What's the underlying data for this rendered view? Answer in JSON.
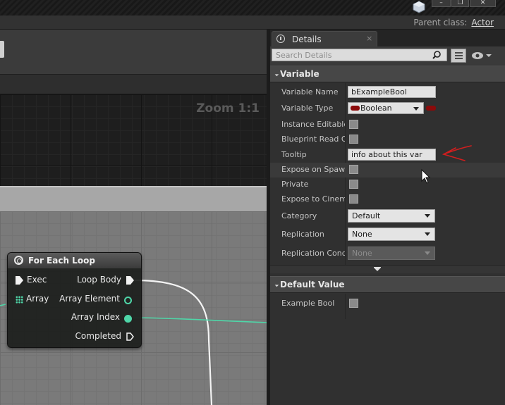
{
  "window": {
    "minimize_glyph": "–",
    "maximize_glyph": "❐",
    "close_glyph": "✕",
    "logo_icon": "unreal-engine-icon"
  },
  "toolbar": {
    "parent_class_label": "Parent class:",
    "parent_class_value": "Actor"
  },
  "graph": {
    "zoom_label": "Zoom 1:1",
    "node": {
      "title": "For Each Loop",
      "icon": "loop-icon",
      "inputs": [
        {
          "label": "Exec",
          "pin": "exec"
        },
        {
          "label": "Array",
          "pin": "array"
        }
      ],
      "outputs": [
        {
          "label": "Loop Body",
          "pin": "exec"
        },
        {
          "label": "Array Element",
          "pin": "data-hollow"
        },
        {
          "label": "Array Index",
          "pin": "data-filled"
        },
        {
          "label": "Completed",
          "pin": "exec-hollow"
        }
      ]
    },
    "colors": {
      "wire_exec": "#ffffff",
      "wire_int": "#4fd6a8"
    }
  },
  "details": {
    "tab_label": "Details",
    "tab_close": "×",
    "search_placeholder": "Search Details",
    "sections": {
      "variable": "Variable",
      "default_value": "Default Value"
    },
    "properties": {
      "variable_name": {
        "label": "Variable Name",
        "value": "bExampleBool"
      },
      "variable_type": {
        "label": "Variable Type",
        "value": "Boolean"
      },
      "instance_editable": {
        "label": "Instance Editable",
        "checked": false
      },
      "blueprint_read_only": {
        "label": "Blueprint Read Only",
        "checked": false
      },
      "tooltip": {
        "label": "Tooltip",
        "value": "info about this var"
      },
      "expose_on_spawn": {
        "label": "Expose on Spawn",
        "checked": false
      },
      "private": {
        "label": "Private",
        "checked": false
      },
      "expose_to_cinematics": {
        "label": "Expose to Cinematics",
        "checked": false
      },
      "category": {
        "label": "Category",
        "value": "Default"
      },
      "replication": {
        "label": "Replication",
        "value": "None"
      },
      "replication_condition": {
        "label": "Replication Condition",
        "value": "None"
      },
      "example_bool": {
        "label": "Example Bool",
        "checked": false
      }
    },
    "colors": {
      "boolean_type": "#8b0a0a",
      "annotation_arrow": "#d21e1e"
    }
  }
}
